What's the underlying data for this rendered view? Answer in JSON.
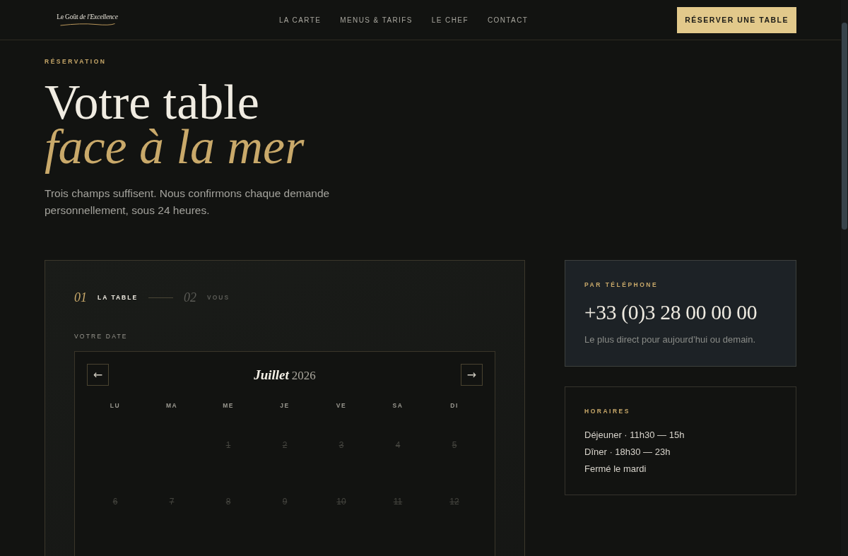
{
  "header": {
    "logo": "Le Goût *de l'Excellence*",
    "nav": [
      {
        "label": "LA CARTE"
      },
      {
        "label": "MENUS & TARIFS"
      },
      {
        "label": "LE CHEF"
      },
      {
        "label": "CONTACT"
      }
    ],
    "cta": "RÉSERVER UNE TABLE"
  },
  "hero": {
    "eyebrow": "RÉSERVATION",
    "title": "Votre table",
    "title_accent": "face à la mer",
    "intro": "Trois champs suffisent. Nous confirmons chaque demande personnellement, sous 24 heures."
  },
  "booking": {
    "steps": [
      {
        "number": "01",
        "label": "LA TABLE",
        "selected": true
      },
      {
        "number": "02",
        "label": "VOUS",
        "selected": false
      }
    ],
    "date_label": "VOTRE DATE",
    "calendar": {
      "prev": "←",
      "next": "→",
      "month": "Juillet",
      "year": "2026",
      "weekdays": [
        "LU",
        "MA",
        "ME",
        "JE",
        "VE",
        "SA",
        "DI"
      ],
      "weeks": [
        {
          "days": [
            {
              "kind": "blank"
            },
            {
              "kind": "blank"
            },
            {
              "kind": "day",
              "day": "1",
              "disabled": true
            },
            {
              "kind": "day",
              "day": "2",
              "disabled": true
            },
            {
              "kind": "day",
              "day": "3",
              "disabled": true
            },
            {
              "kind": "day",
              "day": "4",
              "disabled": true
            },
            {
              "kind": "day",
              "day": "5",
              "disabled": true
            }
          ]
        },
        {
          "days": [
            {
              "kind": "day",
              "day": "6",
              "disabled": true
            },
            {
              "kind": "day",
              "day": "7",
              "disabled": true
            },
            {
              "kind": "day",
              "day": "8",
              "disabled": true
            },
            {
              "kind": "day",
              "day": "9",
              "disabled": true
            },
            {
              "kind": "day",
              "day": "10",
              "disabled": true
            },
            {
              "kind": "day",
              "day": "11",
              "disabled": true
            },
            {
              "kind": "day",
              "day": "12",
              "disabled": true
            }
          ]
        }
      ]
    }
  },
  "phone_card": {
    "eyebrow": "PAR TÉLÉPHONE",
    "number": "+33 (0)3 28 00 00 00",
    "note": "Le plus direct pour aujourd’hui ou demain."
  },
  "hours_card": {
    "eyebrow": "HORAIRES",
    "lines": [
      "Déjeuner · 11h30 — 15h",
      "Dîner · 18h30 — 23h",
      "Fermé le mardi"
    ]
  }
}
